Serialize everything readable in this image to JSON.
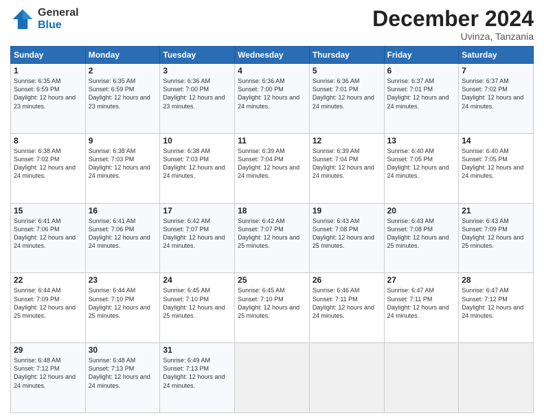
{
  "logo": {
    "general": "General",
    "blue": "Blue"
  },
  "header": {
    "month": "December 2024",
    "location": "Uvinza, Tanzania"
  },
  "days_of_week": [
    "Sunday",
    "Monday",
    "Tuesday",
    "Wednesday",
    "Thursday",
    "Friday",
    "Saturday"
  ],
  "weeks": [
    [
      {
        "day": "1",
        "sunrise": "Sunrise: 6:35 AM",
        "sunset": "Sunset: 6:59 PM",
        "daylight": "Daylight: 12 hours and 23 minutes."
      },
      {
        "day": "2",
        "sunrise": "Sunrise: 6:35 AM",
        "sunset": "Sunset: 6:59 PM",
        "daylight": "Daylight: 12 hours and 23 minutes."
      },
      {
        "day": "3",
        "sunrise": "Sunrise: 6:36 AM",
        "sunset": "Sunset: 7:00 PM",
        "daylight": "Daylight: 12 hours and 23 minutes."
      },
      {
        "day": "4",
        "sunrise": "Sunrise: 6:36 AM",
        "sunset": "Sunset: 7:00 PM",
        "daylight": "Daylight: 12 hours and 24 minutes."
      },
      {
        "day": "5",
        "sunrise": "Sunrise: 6:36 AM",
        "sunset": "Sunset: 7:01 PM",
        "daylight": "Daylight: 12 hours and 24 minutes."
      },
      {
        "day": "6",
        "sunrise": "Sunrise: 6:37 AM",
        "sunset": "Sunset: 7:01 PM",
        "daylight": "Daylight: 12 hours and 24 minutes."
      },
      {
        "day": "7",
        "sunrise": "Sunrise: 6:37 AM",
        "sunset": "Sunset: 7:02 PM",
        "daylight": "Daylight: 12 hours and 24 minutes."
      }
    ],
    [
      {
        "day": "8",
        "sunrise": "Sunrise: 6:38 AM",
        "sunset": "Sunset: 7:02 PM",
        "daylight": "Daylight: 12 hours and 24 minutes."
      },
      {
        "day": "9",
        "sunrise": "Sunrise: 6:38 AM",
        "sunset": "Sunset: 7:03 PM",
        "daylight": "Daylight: 12 hours and 24 minutes."
      },
      {
        "day": "10",
        "sunrise": "Sunrise: 6:38 AM",
        "sunset": "Sunset: 7:03 PM",
        "daylight": "Daylight: 12 hours and 24 minutes."
      },
      {
        "day": "11",
        "sunrise": "Sunrise: 6:39 AM",
        "sunset": "Sunset: 7:04 PM",
        "daylight": "Daylight: 12 hours and 24 minutes."
      },
      {
        "day": "12",
        "sunrise": "Sunrise: 6:39 AM",
        "sunset": "Sunset: 7:04 PM",
        "daylight": "Daylight: 12 hours and 24 minutes."
      },
      {
        "day": "13",
        "sunrise": "Sunrise: 6:40 AM",
        "sunset": "Sunset: 7:05 PM",
        "daylight": "Daylight: 12 hours and 24 minutes."
      },
      {
        "day": "14",
        "sunrise": "Sunrise: 6:40 AM",
        "sunset": "Sunset: 7:05 PM",
        "daylight": "Daylight: 12 hours and 24 minutes."
      }
    ],
    [
      {
        "day": "15",
        "sunrise": "Sunrise: 6:41 AM",
        "sunset": "Sunset: 7:06 PM",
        "daylight": "Daylight: 12 hours and 24 minutes."
      },
      {
        "day": "16",
        "sunrise": "Sunrise: 6:41 AM",
        "sunset": "Sunset: 7:06 PM",
        "daylight": "Daylight: 12 hours and 24 minutes."
      },
      {
        "day": "17",
        "sunrise": "Sunrise: 6:42 AM",
        "sunset": "Sunset: 7:07 PM",
        "daylight": "Daylight: 12 hours and 24 minutes."
      },
      {
        "day": "18",
        "sunrise": "Sunrise: 6:42 AM",
        "sunset": "Sunset: 7:07 PM",
        "daylight": "Daylight: 12 hours and 25 minutes."
      },
      {
        "day": "19",
        "sunrise": "Sunrise: 6:43 AM",
        "sunset": "Sunset: 7:08 PM",
        "daylight": "Daylight: 12 hours and 25 minutes."
      },
      {
        "day": "20",
        "sunrise": "Sunrise: 6:43 AM",
        "sunset": "Sunset: 7:08 PM",
        "daylight": "Daylight: 12 hours and 25 minutes."
      },
      {
        "day": "21",
        "sunrise": "Sunrise: 6:43 AM",
        "sunset": "Sunset: 7:09 PM",
        "daylight": "Daylight: 12 hours and 25 minutes."
      }
    ],
    [
      {
        "day": "22",
        "sunrise": "Sunrise: 6:44 AM",
        "sunset": "Sunset: 7:09 PM",
        "daylight": "Daylight: 12 hours and 25 minutes."
      },
      {
        "day": "23",
        "sunrise": "Sunrise: 6:44 AM",
        "sunset": "Sunset: 7:10 PM",
        "daylight": "Daylight: 12 hours and 25 minutes."
      },
      {
        "day": "24",
        "sunrise": "Sunrise: 6:45 AM",
        "sunset": "Sunset: 7:10 PM",
        "daylight": "Daylight: 12 hours and 25 minutes."
      },
      {
        "day": "25",
        "sunrise": "Sunrise: 6:45 AM",
        "sunset": "Sunset: 7:10 PM",
        "daylight": "Daylight: 12 hours and 25 minutes."
      },
      {
        "day": "26",
        "sunrise": "Sunrise: 6:46 AM",
        "sunset": "Sunset: 7:11 PM",
        "daylight": "Daylight: 12 hours and 24 minutes."
      },
      {
        "day": "27",
        "sunrise": "Sunrise: 6:47 AM",
        "sunset": "Sunset: 7:11 PM",
        "daylight": "Daylight: 12 hours and 24 minutes."
      },
      {
        "day": "28",
        "sunrise": "Sunrise: 6:47 AM",
        "sunset": "Sunset: 7:12 PM",
        "daylight": "Daylight: 12 hours and 24 minutes."
      }
    ],
    [
      {
        "day": "29",
        "sunrise": "Sunrise: 6:48 AM",
        "sunset": "Sunset: 7:12 PM",
        "daylight": "Daylight: 12 hours and 24 minutes."
      },
      {
        "day": "30",
        "sunrise": "Sunrise: 6:48 AM",
        "sunset": "Sunset: 7:13 PM",
        "daylight": "Daylight: 12 hours and 24 minutes."
      },
      {
        "day": "31",
        "sunrise": "Sunrise: 6:49 AM",
        "sunset": "Sunset: 7:13 PM",
        "daylight": "Daylight: 12 hours and 24 minutes."
      },
      null,
      null,
      null,
      null
    ]
  ]
}
